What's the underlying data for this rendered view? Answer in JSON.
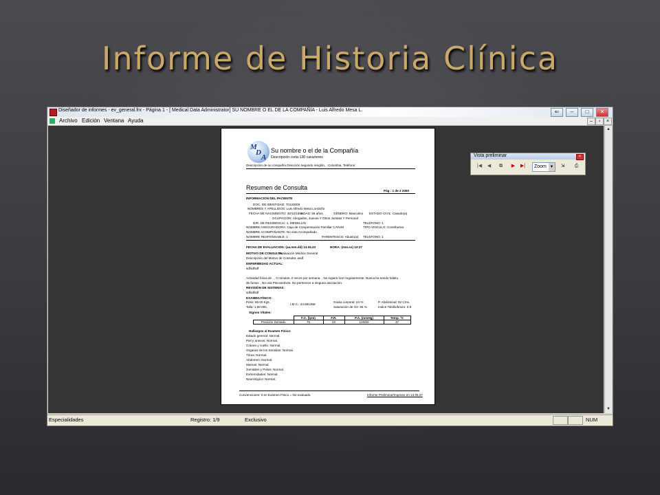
{
  "slide": {
    "title": "Informe de Historia Clínica"
  },
  "window": {
    "title": "Diseñador de informes - ev_general.frx - Página 1 - [ Medical Data Administrator] SU NOMBRE O EL DE LA COMPAÑÍA - Luis Alfredo Mesa L.",
    "menu": [
      "Archivo",
      "Edición",
      "Ventana",
      "Ayuda"
    ]
  },
  "toolbar": {
    "title": "Vista preliminar",
    "zoom_label": "Zoom",
    "buttons": [
      "first-page",
      "previous-page",
      "multi-page",
      "next-page",
      "last-page",
      "zoom-select",
      "go-to",
      "print"
    ]
  },
  "statusbar": {
    "section": "Especialidades",
    "record": "Registro: 1/9",
    "mode": "Exclusivo",
    "num": "NUM"
  },
  "report": {
    "company_name": "Su nombre o el de la Compañía",
    "company_short": "Descripción corta 130 caracteres",
    "company_desc": "Descripción de su compañía Dirección segundo renglón, , Colombia, Teléfono:",
    "logo_text": "MDA",
    "title": "Resumen de Consulta",
    "page_info": "Pág : 1 de 2   2050",
    "section_patient": "INFORMACION DEL PACIENTE",
    "patient": {
      "doc": "DOC. DE IDENTIDAD: 70120009",
      "name": "NOMBRES Y APELLIDOS: Luis Alfredo Mesa Londoño",
      "birth": "FECHA DE NACIMIENTO: 30/12/1956",
      "age": "EDAD: 56 años",
      "gender": "GÉNERO: Masculino",
      "civil": "ESTADO CIVIL: Casado(a)",
      "occupation": "OCUPACIÓN: Abogados, Jueces Y Otros Juristas Y Personal",
      "residence": "DIR. DE RESIDENCIA: 1, MEDELLIN",
      "phone1": "TELÉFONO: 1",
      "insurer": "NOMBRE ASEGURADORA: Caja de Compensación Familiar CAFAM",
      "link_type": "TIPO VINCULO: Contributivo",
      "companion": "NOMBRE ACOMPAÑANTE: No esta Acompañado",
      "responsible": "NOMBRE RESPONSABLE: 1",
      "kinship": "PARENTESCO: Abuelo(a)",
      "phone2": "TELÉFONO: 1"
    },
    "eval_date": "FECHA DE EVALUACION:   (aa.mm.dd) 13.04.23",
    "eval_time": "HORA:      (mm.ss) 13:27",
    "reason_label": "MOTIVO DE CONSULTA:",
    "reason_value": "Evaluación Médica General",
    "reason_desc": "Descripción del Motivo de Consulta: asdf",
    "current_illness_label": "ENFERMEDAD ACTUAL:",
    "current_illness_value": "sdfsdfsdf",
    "activity_1": "Actividad física de , , 0 minutos, 0 veces por semana. , No ingiere licor regularmente. Nunca ha tenido hábito",
    "activity_2": "de fumar. , No usa Psicoactivos. No pertenece a ninguna asociación.",
    "systems_label": "REVISIÓN DE SISTEMAS:",
    "systems_value": "sdfsdfsdf",
    "exam_label": "EXAMEN FÍSICO:",
    "weight": "Peso: 80.00 Kgs.",
    "height": "Talla: 1.80 Mts.",
    "bmi": "I.M.C.: 24.691358",
    "body_fat": "Grasa corporal: 24 %",
    "o2": "Saturación de O2: 95 %",
    "waist": "P. Abdominal: 92 Cms.",
    "tobillo": "Indice Tobillo/brazo: 0.9",
    "vitals_label": "Signos Vitales:",
    "vitals_headers": [
      "",
      "F.C. (lpm)",
      "F.R.",
      "P.A. (mmHg)",
      "Temp. ºC"
    ],
    "vitals_row": [
      "Posición Sentado",
      "75",
      "22",
      "120/80",
      "37"
    ],
    "findings_label": "Hallazgos al Examen Físico:",
    "findings": [
      "Estado general: Normal.",
      "Piel y anexos: Normal.",
      "Cráneo y cuello: Normal.",
      "Organos de los Sentidos: Normal.",
      "Tórax: Normal.",
      "Abdomen: Normal.",
      "Mamas: Normal.",
      "Genitales y Pelvis: Normal.",
      "Extremidades: Normal.",
      "Neurológico: Normal."
    ],
    "footer_left": "Convenciones:  0 en Exámen Físico = No evaluado.",
    "footer_right": "Informe Preliminar/Impreso en 13.05.07"
  },
  "colors": {
    "title_gold": "#c9a96a",
    "workspace": "#353535",
    "page": "#ffffff"
  }
}
